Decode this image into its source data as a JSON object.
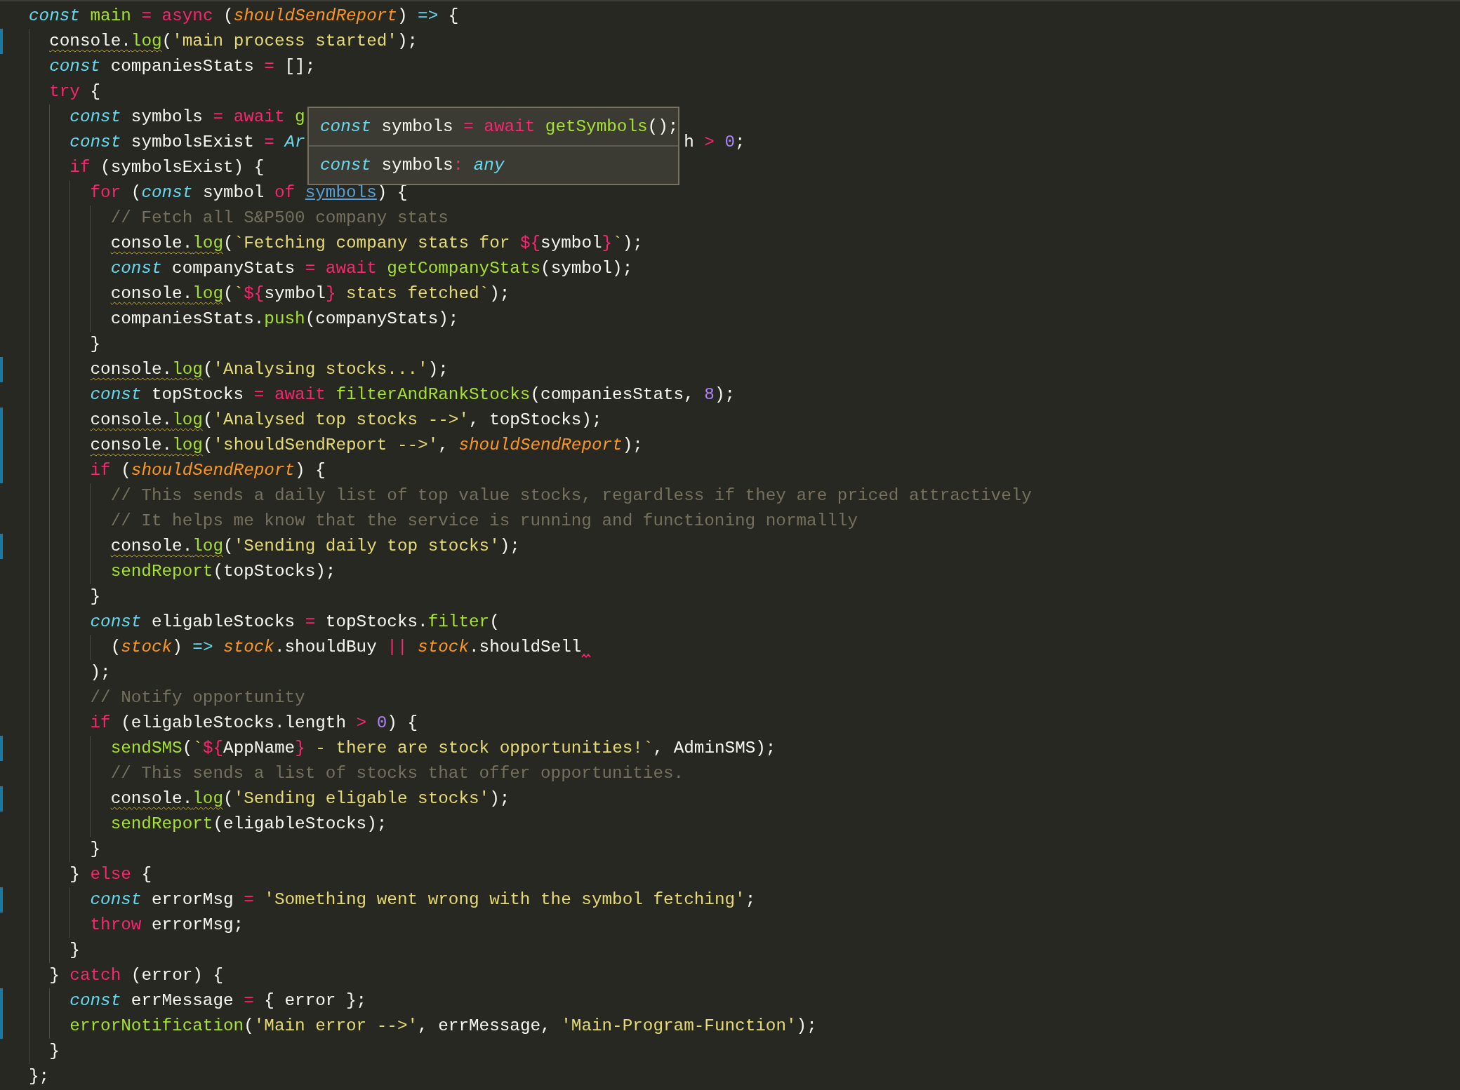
{
  "editor": {
    "lines": [
      {
        "modified": false,
        "tokens": [
          {
            "kind": "storage",
            "text": "const"
          },
          {
            "kind": "function",
            "text": " main"
          },
          {
            "kind": "keyword",
            "text": " ="
          },
          {
            "kind": "keyword",
            "text": " async"
          },
          {
            "kind": "plain",
            "text": " ("
          },
          {
            "kind": "param",
            "text": "shouldSendReport"
          },
          {
            "kind": "plain",
            "text": ") "
          },
          {
            "kind": "storage-plain",
            "text": "=>"
          },
          {
            "kind": "plain",
            "text": " {"
          }
        ]
      },
      {
        "modified": true,
        "tokens": [
          {
            "kind": "plain",
            "text": "  console.",
            "warning": true
          },
          {
            "kind": "function",
            "text": "log",
            "warning": true
          },
          {
            "kind": "plain",
            "text": "("
          },
          {
            "kind": "string",
            "text": "'main process started'"
          },
          {
            "kind": "plain",
            "text": ");"
          }
        ]
      },
      {
        "modified": false,
        "tokens": [
          {
            "kind": "storage",
            "text": "  const"
          },
          {
            "kind": "plain",
            "text": " companiesStats "
          },
          {
            "kind": "keyword",
            "text": "="
          },
          {
            "kind": "plain",
            "text": " [];"
          }
        ]
      },
      {
        "modified": false,
        "tokens": [
          {
            "kind": "keyword",
            "text": "  try"
          },
          {
            "kind": "plain",
            "text": " {"
          }
        ]
      },
      {
        "modified": false,
        "tokens": [
          {
            "kind": "storage",
            "text": "    const"
          },
          {
            "kind": "plain",
            "text": " symbols "
          },
          {
            "kind": "keyword",
            "text": "="
          },
          {
            "kind": "keyword",
            "text": " await"
          },
          {
            "kind": "function",
            "text": " g"
          }
        ]
      },
      {
        "modified": false,
        "tokens": [
          {
            "kind": "storage",
            "text": "    const"
          },
          {
            "kind": "plain",
            "text": " symbolsExist "
          },
          {
            "kind": "keyword",
            "text": "="
          },
          {
            "kind": "storage",
            "text": " Ar"
          },
          {
            "kind": "covered"
          },
          {
            "kind": "plain",
            "text": "h "
          },
          {
            "kind": "keyword",
            "text": ">"
          },
          {
            "kind": "number",
            "text": " 0"
          },
          {
            "kind": "plain",
            "text": ";"
          }
        ]
      },
      {
        "modified": false,
        "tokens": [
          {
            "kind": "keyword",
            "text": "    if"
          },
          {
            "kind": "plain",
            "text": " (symbolsExist) {"
          }
        ]
      },
      {
        "modified": false,
        "tokens": [
          {
            "kind": "keyword",
            "text": "      for"
          },
          {
            "kind": "plain",
            "text": " ("
          },
          {
            "kind": "storage",
            "text": "const"
          },
          {
            "kind": "plain",
            "text": " symbol "
          },
          {
            "kind": "keyword",
            "text": "of "
          },
          {
            "kind": "link",
            "text": "symbols"
          },
          {
            "kind": "plain",
            "text": ") {"
          }
        ]
      },
      {
        "modified": false,
        "tokens": [
          {
            "kind": "comment",
            "text": "        // Fetch all S&P500 company stats"
          }
        ]
      },
      {
        "modified": false,
        "tokens": [
          {
            "kind": "plain",
            "text": "        console.",
            "warning": true
          },
          {
            "kind": "function",
            "text": "log",
            "warning": true
          },
          {
            "kind": "plain",
            "text": "("
          },
          {
            "kind": "string",
            "text": "`Fetching company stats for "
          },
          {
            "kind": "keyword",
            "text": "${"
          },
          {
            "kind": "plain",
            "text": "symbol"
          },
          {
            "kind": "keyword",
            "text": "}"
          },
          {
            "kind": "string",
            "text": "`"
          },
          {
            "kind": "plain",
            "text": ");"
          }
        ]
      },
      {
        "modified": false,
        "tokens": [
          {
            "kind": "storage",
            "text": "        const"
          },
          {
            "kind": "plain",
            "text": " companyStats "
          },
          {
            "kind": "keyword",
            "text": "="
          },
          {
            "kind": "keyword",
            "text": " await"
          },
          {
            "kind": "function",
            "text": " getCompanyStats"
          },
          {
            "kind": "plain",
            "text": "(symbol);"
          }
        ]
      },
      {
        "modified": false,
        "tokens": [
          {
            "kind": "plain",
            "text": "        console.",
            "warning": true
          },
          {
            "kind": "function",
            "text": "log",
            "warning": true
          },
          {
            "kind": "plain",
            "text": "("
          },
          {
            "kind": "string",
            "text": "`"
          },
          {
            "kind": "keyword",
            "text": "${"
          },
          {
            "kind": "plain",
            "text": "symbol"
          },
          {
            "kind": "keyword",
            "text": "}"
          },
          {
            "kind": "string",
            "text": " stats fetched`"
          },
          {
            "kind": "plain",
            "text": ");"
          }
        ]
      },
      {
        "modified": false,
        "tokens": [
          {
            "kind": "plain",
            "text": "        companiesStats."
          },
          {
            "kind": "function",
            "text": "push"
          },
          {
            "kind": "plain",
            "text": "(companyStats);"
          }
        ]
      },
      {
        "modified": false,
        "tokens": [
          {
            "kind": "plain",
            "text": "      }"
          }
        ]
      },
      {
        "modified": true,
        "tokens": [
          {
            "kind": "plain",
            "text": "      console.",
            "warning": true
          },
          {
            "kind": "function",
            "text": "log",
            "warning": true
          },
          {
            "kind": "plain",
            "text": "("
          },
          {
            "kind": "string",
            "text": "'Analysing stocks...'"
          },
          {
            "kind": "plain",
            "text": ");"
          }
        ]
      },
      {
        "modified": false,
        "tokens": [
          {
            "kind": "storage",
            "text": "      const"
          },
          {
            "kind": "plain",
            "text": " topStocks "
          },
          {
            "kind": "keyword",
            "text": "="
          },
          {
            "kind": "keyword",
            "text": " await"
          },
          {
            "kind": "function",
            "text": " filterAndRankStocks"
          },
          {
            "kind": "plain",
            "text": "(companiesStats, "
          },
          {
            "kind": "number",
            "text": "8"
          },
          {
            "kind": "plain",
            "text": ");"
          }
        ]
      },
      {
        "modified": true,
        "tokens": [
          {
            "kind": "plain",
            "text": "      console.",
            "warning": true
          },
          {
            "kind": "function",
            "text": "log",
            "warning": true
          },
          {
            "kind": "plain",
            "text": "("
          },
          {
            "kind": "string",
            "text": "'Analysed top stocks -->'"
          },
          {
            "kind": "plain",
            "text": ", topStocks);"
          }
        ]
      },
      {
        "modified": true,
        "tokens": [
          {
            "kind": "plain",
            "text": "      console.",
            "warning": true
          },
          {
            "kind": "function",
            "text": "log",
            "warning": true
          },
          {
            "kind": "plain",
            "text": "("
          },
          {
            "kind": "string",
            "text": "'shouldSendReport -->'"
          },
          {
            "kind": "plain",
            "text": ", "
          },
          {
            "kind": "param",
            "text": "shouldSendReport"
          },
          {
            "kind": "plain",
            "text": ");"
          }
        ]
      },
      {
        "modified": true,
        "tokens": [
          {
            "kind": "keyword",
            "text": "      if"
          },
          {
            "kind": "plain",
            "text": " ("
          },
          {
            "kind": "param",
            "text": "shouldSendReport"
          },
          {
            "kind": "plain",
            "text": ") {"
          }
        ]
      },
      {
        "modified": false,
        "tokens": [
          {
            "kind": "comment",
            "text": "        // This sends a daily list of top value stocks, regardless if they are priced attractively"
          }
        ]
      },
      {
        "modified": false,
        "tokens": [
          {
            "kind": "comment",
            "text": "        // It helps me know that the service is running and functioning normallly"
          }
        ]
      },
      {
        "modified": true,
        "tokens": [
          {
            "kind": "plain",
            "text": "        console.",
            "warning": true
          },
          {
            "kind": "function",
            "text": "log",
            "warning": true
          },
          {
            "kind": "plain",
            "text": "("
          },
          {
            "kind": "string",
            "text": "'Sending daily top stocks'"
          },
          {
            "kind": "plain",
            "text": ");"
          }
        ]
      },
      {
        "modified": false,
        "tokens": [
          {
            "kind": "function",
            "text": "        sendReport"
          },
          {
            "kind": "plain",
            "text": "(topStocks);"
          }
        ]
      },
      {
        "modified": false,
        "tokens": [
          {
            "kind": "plain",
            "text": "      }"
          }
        ]
      },
      {
        "modified": false,
        "tokens": [
          {
            "kind": "storage",
            "text": "      const"
          },
          {
            "kind": "plain",
            "text": " eligableStocks "
          },
          {
            "kind": "keyword",
            "text": "="
          },
          {
            "kind": "plain",
            "text": " topStocks."
          },
          {
            "kind": "function",
            "text": "filter"
          },
          {
            "kind": "plain",
            "text": "("
          }
        ]
      },
      {
        "modified": false,
        "tokens": [
          {
            "kind": "plain",
            "text": "        ("
          },
          {
            "kind": "param",
            "text": "stock"
          },
          {
            "kind": "plain",
            "text": ") "
          },
          {
            "kind": "storage-plain",
            "text": "=>"
          },
          {
            "kind": "param",
            "text": " stock"
          },
          {
            "kind": "plain",
            "text": ".shouldBuy "
          },
          {
            "kind": "keyword",
            "text": "||"
          },
          {
            "kind": "param",
            "text": " stock"
          },
          {
            "kind": "plain",
            "text": ".shouldSell"
          },
          {
            "kind": "error-mark"
          }
        ]
      },
      {
        "modified": false,
        "tokens": [
          {
            "kind": "plain",
            "text": "      );"
          }
        ]
      },
      {
        "modified": false,
        "tokens": [
          {
            "kind": "comment",
            "text": "      // Notify opportunity"
          }
        ]
      },
      {
        "modified": false,
        "tokens": [
          {
            "kind": "keyword",
            "text": "      if"
          },
          {
            "kind": "plain",
            "text": " (eligableStocks.length "
          },
          {
            "kind": "keyword",
            "text": ">"
          },
          {
            "kind": "number",
            "text": " 0"
          },
          {
            "kind": "plain",
            "text": ") {"
          }
        ]
      },
      {
        "modified": true,
        "tokens": [
          {
            "kind": "function",
            "text": "        sendSMS"
          },
          {
            "kind": "plain",
            "text": "("
          },
          {
            "kind": "string",
            "text": "`"
          },
          {
            "kind": "keyword",
            "text": "${"
          },
          {
            "kind": "plain",
            "text": "AppName"
          },
          {
            "kind": "keyword",
            "text": "}"
          },
          {
            "kind": "string",
            "text": " - there are stock opportunities!`"
          },
          {
            "kind": "plain",
            "text": ", AdminSMS);"
          }
        ]
      },
      {
        "modified": false,
        "tokens": [
          {
            "kind": "comment",
            "text": "        // This sends a list of stocks that offer opportunities."
          }
        ]
      },
      {
        "modified": true,
        "tokens": [
          {
            "kind": "plain",
            "text": "        console.",
            "warning": true
          },
          {
            "kind": "function",
            "text": "log",
            "warning": true
          },
          {
            "kind": "plain",
            "text": "("
          },
          {
            "kind": "string",
            "text": "'Sending eligable stocks'"
          },
          {
            "kind": "plain",
            "text": ");"
          }
        ]
      },
      {
        "modified": false,
        "tokens": [
          {
            "kind": "function",
            "text": "        sendReport"
          },
          {
            "kind": "plain",
            "text": "(eligableStocks);"
          }
        ]
      },
      {
        "modified": false,
        "tokens": [
          {
            "kind": "plain",
            "text": "      }"
          }
        ]
      },
      {
        "modified": false,
        "tokens": [
          {
            "kind": "plain",
            "text": "    } "
          },
          {
            "kind": "keyword",
            "text": "else"
          },
          {
            "kind": "plain",
            "text": " {"
          }
        ]
      },
      {
        "modified": true,
        "tokens": [
          {
            "kind": "storage",
            "text": "      const"
          },
          {
            "kind": "plain",
            "text": " errorMsg "
          },
          {
            "kind": "keyword",
            "text": "="
          },
          {
            "kind": "string",
            "text": " 'Something went wrong with the symbol fetching'"
          },
          {
            "kind": "plain",
            "text": ";"
          }
        ]
      },
      {
        "modified": false,
        "tokens": [
          {
            "kind": "keyword",
            "text": "      throw"
          },
          {
            "kind": "plain",
            "text": " errorMsg;"
          }
        ]
      },
      {
        "modified": false,
        "tokens": [
          {
            "kind": "plain",
            "text": "    }"
          }
        ]
      },
      {
        "modified": false,
        "tokens": [
          {
            "kind": "plain",
            "text": "  } "
          },
          {
            "kind": "keyword",
            "text": "catch"
          },
          {
            "kind": "plain",
            "text": " (error) {"
          }
        ]
      },
      {
        "modified": true,
        "tokens": [
          {
            "kind": "storage",
            "text": "    const"
          },
          {
            "kind": "plain",
            "text": " errMessage "
          },
          {
            "kind": "keyword",
            "text": "="
          },
          {
            "kind": "plain",
            "text": " { error };"
          }
        ]
      },
      {
        "modified": true,
        "tokens": [
          {
            "kind": "function",
            "text": "    errorNotification"
          },
          {
            "kind": "plain",
            "text": "("
          },
          {
            "kind": "string",
            "text": "'Main error -->'"
          },
          {
            "kind": "plain",
            "text": ", errMessage, "
          },
          {
            "kind": "string",
            "text": "'Main-Program-Function'"
          },
          {
            "kind": "plain",
            "text": ");"
          }
        ]
      },
      {
        "modified": false,
        "tokens": [
          {
            "kind": "plain",
            "text": "  }"
          }
        ]
      },
      {
        "modified": false,
        "tokens": [
          {
            "kind": "plain",
            "text": "};"
          }
        ]
      }
    ],
    "tooltip": {
      "rows": [
        [
          {
            "kind": "storage",
            "text": "const"
          },
          {
            "kind": "plain",
            "text": " symbols "
          },
          {
            "kind": "keyword",
            "text": "="
          },
          {
            "kind": "keyword",
            "text": " await"
          },
          {
            "kind": "function",
            "text": " getSymbols"
          },
          {
            "kind": "plain",
            "text": "();"
          }
        ],
        [
          {
            "kind": "storage",
            "text": "const"
          },
          {
            "kind": "plain",
            "text": " symbols"
          },
          {
            "kind": "keyword",
            "text": ":"
          },
          {
            "kind": "storage",
            "text": " any"
          }
        ]
      ]
    }
  }
}
